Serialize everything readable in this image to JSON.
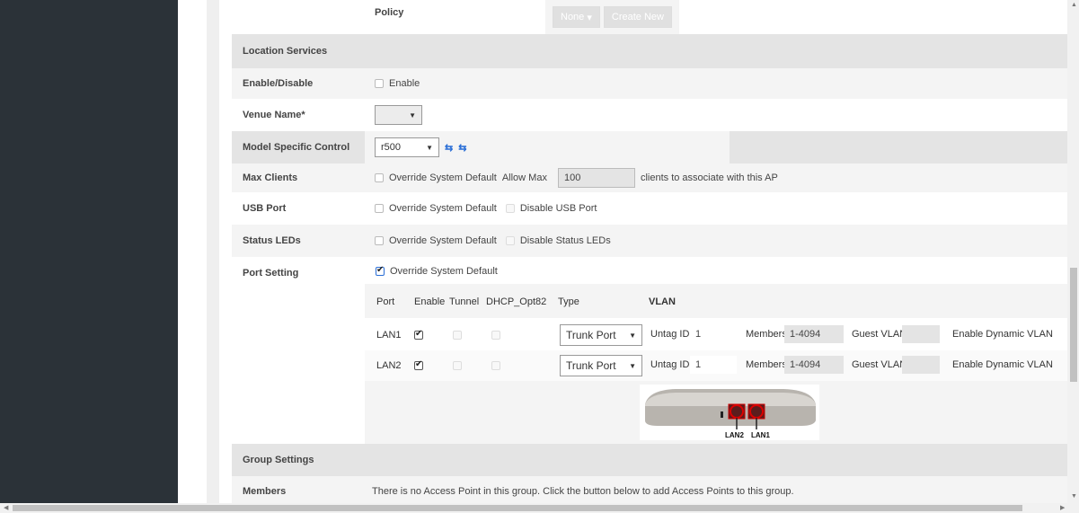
{
  "policy": {
    "label": "Policy",
    "select_value": "None",
    "button": "Create New"
  },
  "location_services": {
    "title": "Location Services"
  },
  "enable_disable": {
    "label": "Enable/Disable",
    "checkbox_label": "Enable"
  },
  "venue_name": {
    "label": "Venue Name*"
  },
  "model_specific": {
    "label": "Model Specific Control",
    "model": "r500"
  },
  "max_clients": {
    "label": "Max Clients",
    "override": "Override System Default",
    "allow_max": "Allow Max",
    "value": "100",
    "suffix": "clients to associate with this AP"
  },
  "usb_port": {
    "label": "USB Port",
    "override": "Override System Default",
    "disable": "Disable USB Port"
  },
  "status_leds": {
    "label": "Status LEDs",
    "override": "Override System Default",
    "disable": "Disable Status LEDs"
  },
  "port_setting": {
    "label": "Port Setting",
    "override": "Override System Default",
    "headers": {
      "port": "Port",
      "enable": "Enable",
      "tunnel": "Tunnel",
      "dhcp": "DHCP_Opt82",
      "type": "Type",
      "vlan": "VLAN"
    },
    "rows": [
      {
        "port": "LAN1",
        "type": "Trunk Port",
        "untag_label": "Untag ID",
        "untag": "1",
        "members_label": "Members",
        "members": "1-4094",
        "guest": "Guest VLAN",
        "dynamic": "Enable Dynamic VLAN"
      },
      {
        "port": "LAN2",
        "type": "Trunk Port",
        "untag_label": "Untag ID",
        "untag": "1",
        "members_label": "Members",
        "members": "1-4094",
        "guest": "Guest VLAN",
        "dynamic": "Enable Dynamic VLAN"
      }
    ],
    "image_labels": {
      "lan2": "LAN2",
      "lan1": "LAN1"
    }
  },
  "group_settings": {
    "title": "Group Settings"
  },
  "members": {
    "label": "Members",
    "text": "There is no Access Point in this group. Click the button below to add Access Points to this group."
  }
}
